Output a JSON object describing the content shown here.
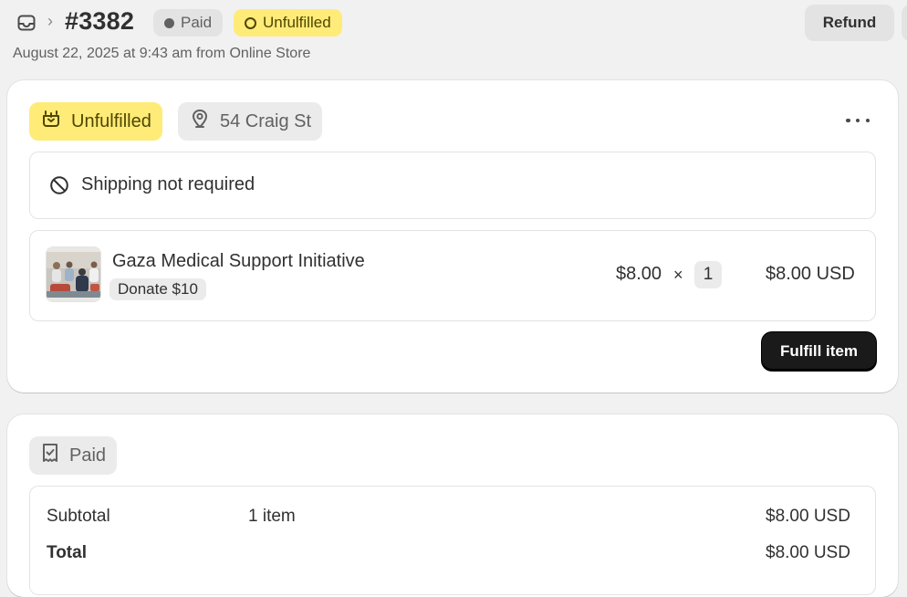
{
  "header": {
    "order_number": "#3382",
    "payment_status": "Paid",
    "fulfillment_status": "Unfulfilled",
    "subtitle": "August 22, 2025 at 9:43 am from Online Store",
    "refund_label": "Refund"
  },
  "fulfillment_card": {
    "status_badge": "Unfulfilled",
    "location": "54 Craig St",
    "shipping_note": "Shipping not required",
    "item": {
      "title": "Gaza Medical Support Initiative",
      "variant": "Donate $10",
      "unit_price": "$8.00",
      "times": "×",
      "quantity": "1",
      "line_total": "$8.00 USD"
    },
    "fulfill_button": "Fulfill item"
  },
  "payment_card": {
    "status_badge": "Paid",
    "rows": [
      {
        "label": "Subtotal",
        "detail": "1 item",
        "amount": "$8.00 USD"
      },
      {
        "label": "Total",
        "detail": "",
        "amount": "$8.00 USD"
      }
    ]
  },
  "colors": {
    "attention_yellow": "#ffeb78",
    "neutral_badge": "#e3e3e3",
    "primary_button": "#1a1a1a"
  },
  "icons": [
    "inbox-icon",
    "chevron-right-icon",
    "fulfillment-box-icon",
    "location-pin-icon",
    "more-horizontal-icon",
    "no-shipping-icon",
    "receipt-check-icon"
  ]
}
